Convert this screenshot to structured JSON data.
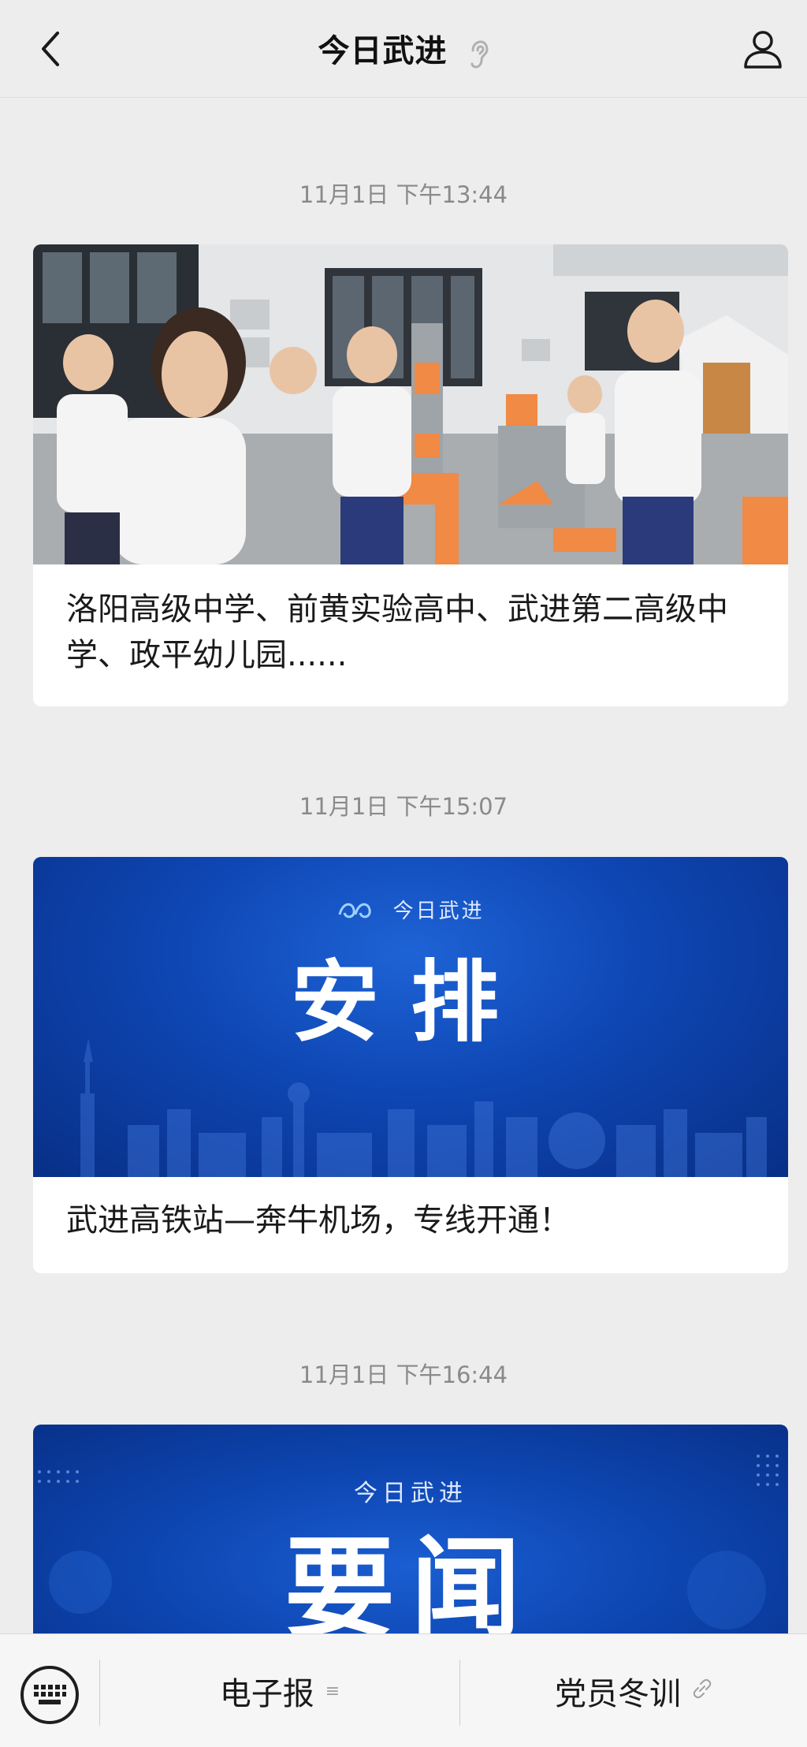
{
  "header": {
    "title": "今日武进",
    "back_icon": "chevron-left-icon",
    "listen_icon": "ear-icon",
    "profile_icon": "person-icon"
  },
  "feed": [
    {
      "timestamp": "11月1日 下午13:44",
      "title": "洛阳高级中学、前黄实验高中、武进第二高级中学、政平幼儿园......"
    },
    {
      "timestamp": "11月1日 下午15:07",
      "banner_brand": "今日武进",
      "banner_word": "安排",
      "title": "武进高铁站—奔牛机场，专线开通！"
    },
    {
      "timestamp": "11月1日 下午16:44",
      "banner_brand": "今日武进",
      "banner_word": "要闻"
    }
  ],
  "bottom_menu": {
    "keyboard_icon": "keyboard-icon",
    "items": [
      {
        "label": "电子报",
        "icon": "menu-lines-icon"
      },
      {
        "label": "党员冬训",
        "icon": "link-icon"
      }
    ]
  },
  "colors": {
    "background": "#ededed",
    "banner_blue": "#0e46b3"
  }
}
